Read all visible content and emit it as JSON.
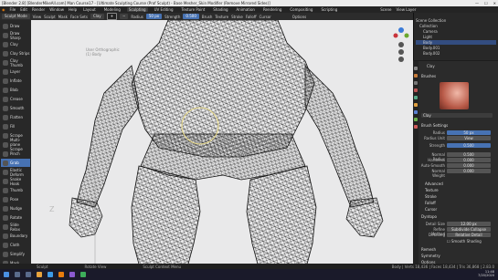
{
  "window": {
    "title": "[Blender 2.8] [BlenderMikeAll.com] Man Course17 - [Ultimate Sculpting Course (Prof Sculpt) - Base Mesher_Skin Modifier (Remove Mirrored Sides)]",
    "controls": [
      "—",
      "☐",
      "✕"
    ]
  },
  "menubar": {
    "items": [
      "File",
      "Edit",
      "Render",
      "Window",
      "Help"
    ],
    "workspaces": [
      "Layout",
      "Modeling",
      "Sculpting",
      "UV Editing",
      "Texture Paint",
      "Shading",
      "Animation",
      "Rendering",
      "Compositing",
      "Scripting"
    ],
    "active_workspace": "Sculpting",
    "scene": "Scene",
    "view_layer": "View Layer"
  },
  "headerbar": {
    "mode": "Sculpt Mode",
    "buttons": [
      "View",
      "Sculpt",
      "Mask",
      "Face Sets"
    ],
    "brush": "Clay",
    "radius_label": "Radius",
    "radius_value": "50 px",
    "strength_label": "Strength",
    "strength_value": "0.500",
    "add": "+",
    "subtract": "−",
    "brush_menus": [
      "Brush",
      "Texture",
      "Stroke",
      "Falloff",
      "Cursor"
    ],
    "overlay": "Options"
  },
  "tools": [
    {
      "label": "Draw",
      "active": false
    },
    {
      "label": "Draw Sharp",
      "active": false
    },
    {
      "label": "Clay",
      "active": false
    },
    {
      "label": "Clay Strips",
      "active": false
    },
    {
      "label": "Clay Thumb",
      "active": false
    },
    {
      "label": "Layer",
      "active": false
    },
    {
      "label": "Inflate",
      "active": false
    },
    {
      "label": "Blob",
      "active": false
    },
    {
      "label": "Crease",
      "active": false
    },
    {
      "label": "Smooth",
      "active": false
    },
    {
      "label": "Flatten",
      "active": false
    },
    {
      "label": "Fill",
      "active": false
    },
    {
      "label": "Scrape",
      "active": false
    },
    {
      "label": "Multi-plane Scrape",
      "active": false
    },
    {
      "label": "Pinch",
      "active": false
    },
    {
      "label": "Grab",
      "active": true
    },
    {
      "label": "Elastic Deform",
      "active": false
    },
    {
      "label": "Snake Hook",
      "active": false
    },
    {
      "label": "Thumb",
      "active": false
    },
    {
      "label": "Pose",
      "active": false
    },
    {
      "label": "Nudge",
      "active": false
    },
    {
      "label": "Rotate",
      "active": false
    },
    {
      "label": "Slide Relax",
      "active": false
    },
    {
      "label": "Boundary",
      "active": false
    },
    {
      "label": "Cloth",
      "active": false
    },
    {
      "label": "Simplify",
      "active": false
    },
    {
      "label": "Mask",
      "active": false
    }
  ],
  "viewport": {
    "info_lines": [
      "User Orthographic",
      "(1) Body"
    ],
    "axis_label": "Z"
  },
  "outliner": {
    "header": "Scene Collection",
    "rows": [
      "Collection",
      "Camera",
      "Light",
      "Body",
      "Body.001",
      "Body.002"
    ],
    "selected_index": 3
  },
  "properties": {
    "brush_name": "Clay",
    "brush_section": "Brushes",
    "preset": "Clay",
    "brush_settings_header": "Brush Settings",
    "fields": [
      {
        "label": "Radius",
        "value": "50 px"
      },
      {
        "label": "Radius Unit",
        "value": "View"
      },
      {
        "label": "Strength",
        "value": "0.500"
      },
      {
        "label": "Normal Radius",
        "value": "0.500"
      },
      {
        "label": "Hardness",
        "value": "0.000"
      },
      {
        "label": "Auto-Smooth",
        "value": "0.000"
      },
      {
        "label": "Normal Weight",
        "value": "0.000"
      }
    ],
    "sections": [
      "Advanced",
      "Texture",
      "Stroke",
      "Falloff",
      "Cursor"
    ],
    "dyntopo_header": "Dyntopo",
    "dyntopo_fields": [
      {
        "label": "Detail Size",
        "value": "12.00 px"
      },
      {
        "label": "Refine Method",
        "value": "Subdivide Collapse"
      },
      {
        "label": "Detailing",
        "value": "Relative Detail"
      }
    ],
    "smooth_shading": "Smooth Shading",
    "lower_sections": [
      "Remesh",
      "Symmetry",
      "Options"
    ]
  },
  "statusbar": {
    "items": [
      "Sculpt",
      "Rotate View",
      "Sculpt Context Menu"
    ],
    "stats": "Body | Verts 18,436 | Faces 18,434 | Tris 36,868 | 2.83.0"
  },
  "taskbar": {
    "time": "11:48",
    "date": "7/20/2020"
  },
  "colors": {
    "accent": "#4772b3",
    "brush_circle": "#e6d88a",
    "wire": "#1e1e1e"
  }
}
